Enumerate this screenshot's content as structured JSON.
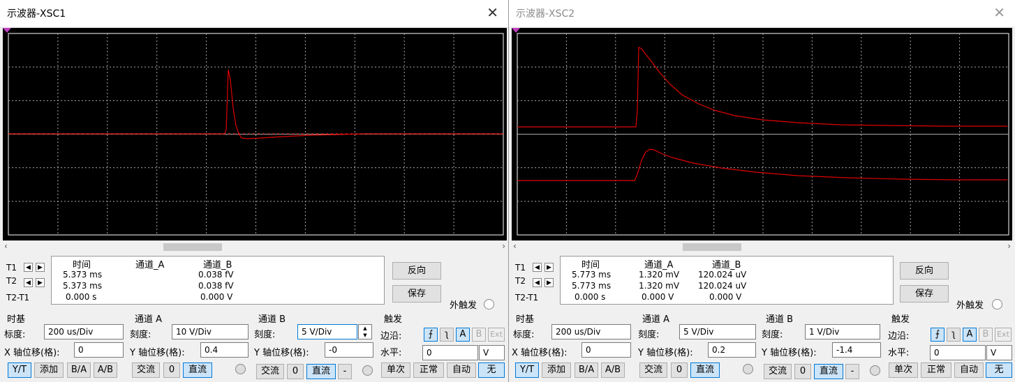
{
  "windows": [
    {
      "title": "示波器-XSC1",
      "readout": {
        "headers": [
          "时间",
          "通道_A",
          "通道_B"
        ],
        "rows": [
          {
            "label": "T1",
            "time": "5.373 ms",
            "a": "",
            "b": "0.038 fV"
          },
          {
            "label": "T2",
            "time": "5.373 ms",
            "a": "",
            "b": "0.038 fV"
          },
          {
            "label": "T2-T1",
            "time": "0.000 s",
            "a": "",
            "b": "0.000 V"
          }
        ]
      },
      "buttons": {
        "reverse": "反向",
        "save": "保存"
      },
      "ext_trigger": "外触发",
      "timebase": {
        "title": "时基",
        "scale_label": "标度:",
        "scale": "200 us/Div",
        "xpos_label": "X 轴位移(格):",
        "xpos": "0",
        "modes": [
          "Y/T",
          "添加",
          "B/A",
          "A/B"
        ]
      },
      "channel_a": {
        "title": "通道 A",
        "scale_label": "刻度:",
        "scale": "10  V/Div",
        "ypos_label": "Y 轴位移(格):",
        "ypos": "0.4",
        "coupling": [
          "交流",
          "0",
          "直流"
        ]
      },
      "channel_b": {
        "title": "通道 B",
        "scale_label": "刻度:",
        "scale": "5  V/Div",
        "ypos_label": "Y 轴位移(格):",
        "ypos": "-0",
        "coupling": [
          "交流",
          "0",
          "直流",
          "-"
        ]
      },
      "trigger": {
        "title": "触发",
        "edge_label": "边沿:",
        "edge_buttons": [
          "A",
          "B",
          "Ext"
        ],
        "level_label": "水平:",
        "level": "0",
        "unit": "V",
        "modes": [
          "单次",
          "正常",
          "自动",
          "无"
        ]
      },
      "colors": {
        "trace": "#e00000",
        "grid": "#aaaaaa",
        "border": "#ffffff"
      },
      "scroll_icons": {
        "left": "‹",
        "right": "›"
      }
    },
    {
      "title": "示波器-XSC2",
      "readout": {
        "headers": [
          "时间",
          "通道_A",
          "通道_B"
        ],
        "rows": [
          {
            "label": "T1",
            "time": "5.773 ms",
            "a": "1.320 mV",
            "b": "120.024 uV"
          },
          {
            "label": "T2",
            "time": "5.773 ms",
            "a": "1.320 mV",
            "b": "120.024 uV"
          },
          {
            "label": "T2-T1",
            "time": "0.000 s",
            "a": "0.000 V",
            "b": "0.000 V"
          }
        ]
      },
      "buttons": {
        "reverse": "反向",
        "save": "保存"
      },
      "ext_trigger": "外触发",
      "timebase": {
        "title": "时基",
        "scale_label": "标度:",
        "scale": "200 us/Div",
        "xpos_label": "X 轴位移(格):",
        "xpos": "0",
        "modes": [
          "Y/T",
          "添加",
          "B/A",
          "A/B"
        ]
      },
      "channel_a": {
        "title": "通道 A",
        "scale_label": "刻度:",
        "scale": "5  V/Div",
        "ypos_label": "Y 轴位移(格):",
        "ypos": "0.2",
        "coupling": [
          "交流",
          "0",
          "直流"
        ]
      },
      "channel_b": {
        "title": "通道 B",
        "scale_label": "刻度:",
        "scale": "1  V/Div",
        "ypos_label": "Y 轴位移(格):",
        "ypos": "-1.4",
        "coupling": [
          "交流",
          "0",
          "直流",
          "-"
        ]
      },
      "trigger": {
        "title": "触发",
        "edge_label": "边沿:",
        "edge_buttons": [
          "A",
          "B",
          "Ext"
        ],
        "level_label": "水平:",
        "level": "0",
        "unit": "V",
        "modes": [
          "单次",
          "正常",
          "自动",
          "无"
        ]
      },
      "colors": {
        "trace": "#e00000",
        "grid": "#aaaaaa",
        "border": "#ffffff"
      },
      "scroll_icons": {
        "left": "‹",
        "right": "›"
      }
    }
  ]
}
